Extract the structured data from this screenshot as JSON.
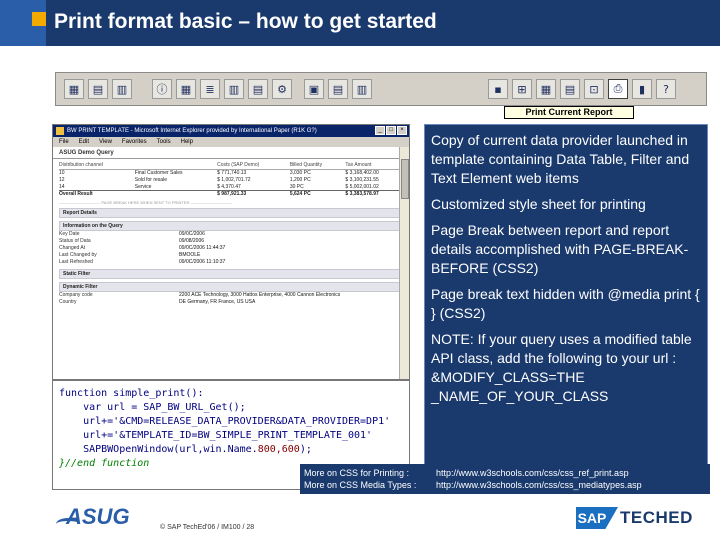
{
  "slide": {
    "title": "Print format basic – how to get started"
  },
  "toolbar": {
    "tooltip": "Print Current Report"
  },
  "browser": {
    "window_title": "BW PRINT TEMPLATE - Microsoft Internet Explorer provided by International Paper (R1K G?)",
    "menu": [
      "File",
      "Edit",
      "View",
      "Favorites",
      "Tools",
      "Help"
    ],
    "query_title": "ASUG Demo Query",
    "table": {
      "headers": [
        "Distribution channel",
        "",
        "Costs (SAP Demo)",
        "Billed Quantity",
        "Tax Amount"
      ],
      "rows": [
        [
          "10",
          "Final Customer Sales",
          "$ 771,740.13",
          "3,030 PC",
          "$ 3,168,402.00"
        ],
        [
          "12",
          "Sold for resale",
          "$ 1,002,701.72",
          "1,200 PC",
          "$ 3,100,231.55"
        ],
        [
          "14",
          "Service",
          "$ 4,370.47",
          "30 PC",
          "$ 5,002,001.02"
        ]
      ],
      "total": [
        "Overall Result",
        "",
        "$ 987,921.33",
        "5,624 PC",
        "$ 3,383,578.97"
      ]
    },
    "separator": "------------------------------- PAGE BREAK HERE WHEN SENT TO PRINTER -------------------------------",
    "report_details": "Report Details",
    "info_section": "Information on the Query",
    "info_items": [
      {
        "k": "Key Date",
        "v": "09/0C/2006"
      },
      {
        "k": "Status of Data",
        "v": "09/08/2006"
      },
      {
        "k": "Changed At",
        "v": "09/0C/2006 11:44:37"
      },
      {
        "k": "Last Changed by",
        "v": "BMOOLE"
      },
      {
        "k": "Last Refreshed",
        "v": "09/0C/2006 11:10:37"
      }
    ],
    "static_filter": "Static Filter",
    "dynamic_filter": "Dynamic Filter",
    "filter_items": [
      {
        "k": "Company code",
        "v": "2200 ACE Technology, 3000 Hattos Enterprise, 4000 Cannon Electronics"
      },
      {
        "k": "Country",
        "v": "DE Germany, FR France, US USA"
      }
    ]
  },
  "code": {
    "line1": "function simple_print():",
    "line2": "    var url = SAP_BW_URL_Get();",
    "line3": "    url+='&CMD=RELEASE_DATA_PROVIDER&DATA_PROVIDER=DP1'",
    "line4": "    url+='&TEMPLATE_ID=BW_SIMPLE_PRINT_TEMPLATE_001'",
    "line5a": "    SAPBWOpenWindow(url,win.Name.",
    "line5b": "800,600",
    "line5c": ");",
    "line6": "}//end function"
  },
  "info": {
    "p1": "Copy of current data provider launched in template containing Data Table, Filter and Text Element web items",
    "p2": "Customized style sheet for printing",
    "p3": " Page Break between report and report details accomplished with PAGE-BREAK-BEFORE (CSS2)",
    "p4": " Page break text hidden with @media print { } (CSS2)",
    "p5": "NOTE: If your query uses a modified table API class, add the following to your url : &MODIFY_CLASS=THE _NAME_OF_YOUR_CLASS"
  },
  "links": {
    "printing_label": "More on CSS for Printing :",
    "printing_url": "http://www.w3schools.com/css/css_ref_print.asp",
    "media_label": "More on CSS Media Types :",
    "media_url": "http://www.w3schools.com/css/css_mediatypes.asp"
  },
  "footer": {
    "asug": "ASUG",
    "copyright": "© SAP TechEd'06 / IM100 / 28",
    "sap": "SAP",
    "teched": "TECHED"
  },
  "colors": {
    "navy": "#1a3a6e",
    "accent": "#f2a900",
    "sap_blue": "#1a6fc0"
  }
}
